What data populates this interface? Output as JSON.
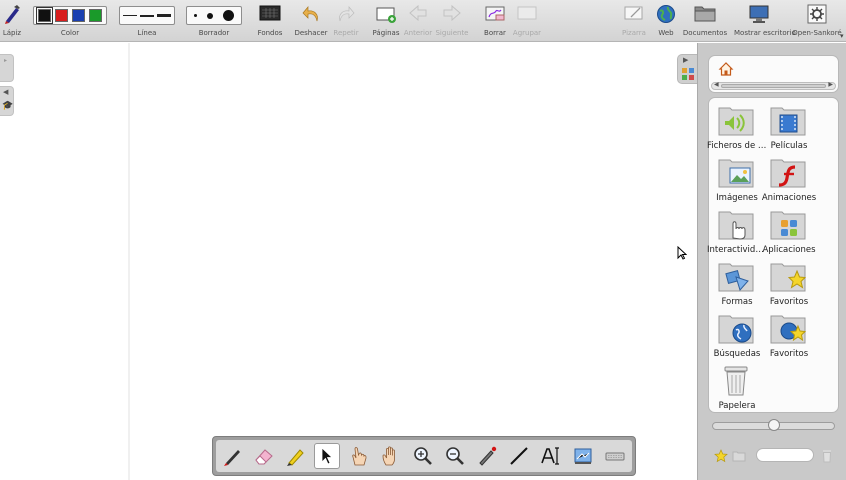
{
  "toolbar": {
    "pen_label": "Lápiz",
    "color_label": "Color",
    "line_label": "Línea",
    "eraser_label": "Borrador",
    "backgrounds_label": "Fondos",
    "undo_label": "Deshacer",
    "redo_label": "Repetir",
    "pages_label": "Páginas",
    "back_label": "Anterior",
    "next_label": "Siguiente",
    "erase_label": "Borrar",
    "group_label": "Agrupar",
    "board_label": "Pizarra",
    "web_label": "Web",
    "documents_label": "Documentos",
    "desktop_label": "Mostrar escritorio",
    "open_sankore_label": "Open-Sankoré",
    "colors": [
      "#111111",
      "#d81e1e",
      "#1a3fb0",
      "#1a9a2a"
    ]
  },
  "library": {
    "items": [
      {
        "label": "Ficheros de audio",
        "icon": "audio-folder-icon"
      },
      {
        "label": "Películas",
        "icon": "movies-folder-icon"
      },
      {
        "label": "Imágenes",
        "icon": "images-folder-icon"
      },
      {
        "label": "Animaciones",
        "icon": "animations-folder-icon"
      },
      {
        "label": "Interactividades",
        "icon": "interactive-folder-icon"
      },
      {
        "label": "Aplicaciones",
        "icon": "applications-folder-icon"
      },
      {
        "label": "Formas",
        "icon": "shapes-folder-icon"
      },
      {
        "label": "Favoritos",
        "icon": "favorites-folder-icon"
      },
      {
        "label": "Búsquedas",
        "icon": "search-folder-icon"
      },
      {
        "label": "Favoritos",
        "icon": "web-favorites-folder-icon"
      },
      {
        "label": "Papelera",
        "icon": "trash-icon"
      }
    ],
    "zoom_level": 0.5,
    "search_placeholder": ""
  },
  "bottom_tools": [
    "pen",
    "eraser",
    "marker",
    "selector",
    "interact",
    "hand",
    "zoom-in",
    "zoom-out",
    "laser-pointer",
    "line",
    "text",
    "capture",
    "virtual-keyboard"
  ]
}
